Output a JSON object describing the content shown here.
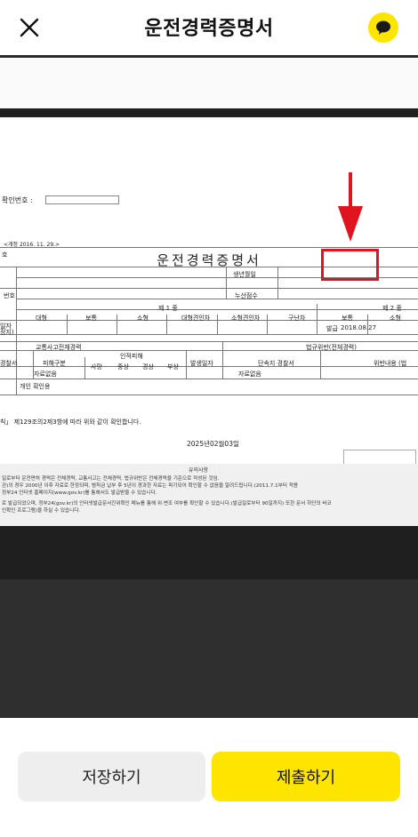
{
  "header": {
    "title": "운전경력증명서"
  },
  "document": {
    "confirm_label": "확인번호 :",
    "revision": "<개정 2016. 11. 29.>",
    "left_stub_1": "호",
    "main_title": "운전경력증명서",
    "birth_label": "생년월일",
    "license_no_label": "번호",
    "points_label": "누산점수",
    "class1_label": "제 1 종",
    "class2_label": "제 2 종",
    "cols": [
      "대형",
      "보통",
      "소형",
      "대형견인차",
      "소형견인차",
      "구난차",
      "보통",
      "소형"
    ],
    "left_stub_2": "일자",
    "left_stub_3": "정지)",
    "issue_label": "발급",
    "issue_date": "2018.08.27",
    "accident_header": "교통사고전체경력",
    "violation_header": "법규위반(전체경력)",
    "police_label": "경찰서",
    "damage_type": "피해구분",
    "casualty_label": "인적피해",
    "casualty_cols": [
      "사망",
      "중상",
      "경상",
      "부상"
    ],
    "occurrence_date": "발생일자",
    "enforcement_police": "단속지 경찰서",
    "violation_content": "위반내용 (법",
    "no_record_1": "자료없음",
    "no_record_2": "자료없음",
    "personal_confirm": "개인 확인용",
    "legal_text": "칙」 제129조의2제3항에 따라 위와 같이 확인합니다.",
    "doc_date": "2025년02월03일",
    "notes_title": "유의사항",
    "notes_lines": [
      "일로부터 운전면허 경력은 전체경력, 교통사고는 전체경력, 법규위반은 전체경력을 기준으로 작성된 것임.",
      "관)의 경우 2000년 이후 자료로 한정되며, 범칙금 납부 후 5년이 경과한 자료는 파기되어 확인할 수 없음을 알려드립니다.(2011.7.1부터 적용",
      "정부24 인터넷 홈페이지(www.gov.kr)를 통해서도 발급받을 수 있습니다.",
      "로 발급되었으며, 정부24(gov.kr)의 인터넷발급문서진위확인 메뉴를 통해 위·변조 여부를 확인할 수 있습니다.(발급일로부터 90일까지) 또한 문서 하단의 바코",
      "인확인 프로그램)을 하실 수 있습니다."
    ]
  },
  "bottom": {
    "save_label": "저장하기",
    "submit_label": "제출하기"
  },
  "colors": {
    "accent": "#fee500",
    "highlight": "#e0141e"
  },
  "icons": {
    "close": "close-icon",
    "chat": "chat-bubble-icon"
  }
}
